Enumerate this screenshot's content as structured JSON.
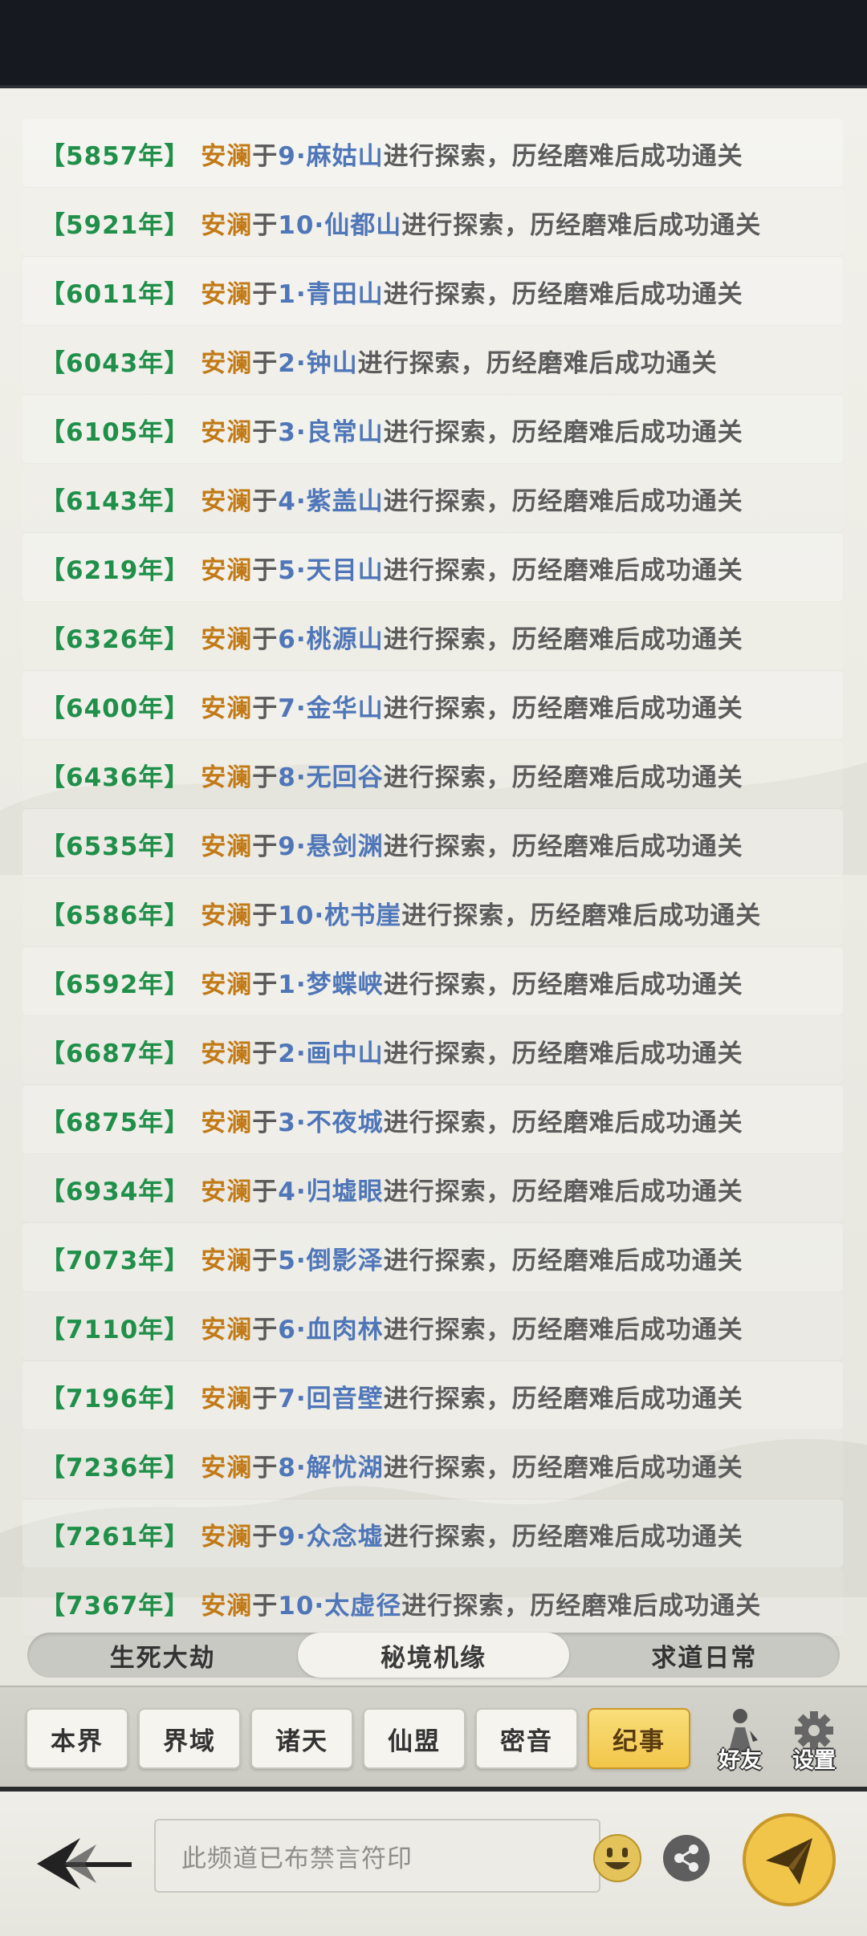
{
  "log": {
    "verb": "进行探索，历经磨难后成功通关",
    "yu": "于",
    "entries": [
      {
        "year": "【5857年】",
        "name": "安澜",
        "place": "9·麻姑山"
      },
      {
        "year": "【5921年】",
        "name": "安澜",
        "place": "10·仙都山"
      },
      {
        "year": "【6011年】",
        "name": "安澜",
        "place": "1·青田山"
      },
      {
        "year": "【6043年】",
        "name": "安澜",
        "place": "2·钟山"
      },
      {
        "year": "【6105年】",
        "name": "安澜",
        "place": "3·良常山"
      },
      {
        "year": "【6143年】",
        "name": "安澜",
        "place": "4·紫盖山"
      },
      {
        "year": "【6219年】",
        "name": "安澜",
        "place": "5·天目山"
      },
      {
        "year": "【6326年】",
        "name": "安澜",
        "place": "6·桃源山"
      },
      {
        "year": "【6400年】",
        "name": "安澜",
        "place": "7·金华山"
      },
      {
        "year": "【6436年】",
        "name": "安澜",
        "place": "8·无回谷"
      },
      {
        "year": "【6535年】",
        "name": "安澜",
        "place": "9·悬剑渊"
      },
      {
        "year": "【6586年】",
        "name": "安澜",
        "place": "10·枕书崖"
      },
      {
        "year": "【6592年】",
        "name": "安澜",
        "place": "1·梦蝶峡"
      },
      {
        "year": "【6687年】",
        "name": "安澜",
        "place": "2·画中山"
      },
      {
        "year": "【6875年】",
        "name": "安澜",
        "place": "3·不夜城"
      },
      {
        "year": "【6934年】",
        "name": "安澜",
        "place": "4·归墟眼"
      },
      {
        "year": "【7073年】",
        "name": "安澜",
        "place": "5·倒影泽"
      },
      {
        "year": "【7110年】",
        "name": "安澜",
        "place": "6·血肉林"
      },
      {
        "year": "【7196年】",
        "name": "安澜",
        "place": "7·回音壁"
      },
      {
        "year": "【7236年】",
        "name": "安澜",
        "place": "8·解忧湖"
      },
      {
        "year": "【7261年】",
        "name": "安澜",
        "place": "9·众念墟"
      },
      {
        "year": "【7367年】",
        "name": "安澜",
        "place": "10·太虚径"
      }
    ]
  },
  "subtabs": [
    "生死大劫",
    "秘境机缘",
    "求道日常"
  ],
  "subtab_active": "秘境机缘",
  "channels": [
    "本界",
    "界域",
    "诸天",
    "仙盟",
    "密音",
    "纪事"
  ],
  "channel_active": "纪事",
  "side": {
    "friends": "好友",
    "settings": "设置"
  },
  "input": {
    "placeholder": "此频道已布禁言符印"
  },
  "colors": {
    "year": "#1f8f4a",
    "name": "#c27a16",
    "place": "#4f76b8",
    "active_tab": "#f2c64a"
  },
  "icons": {
    "back": "back-arrow-icon",
    "emoji": "emoji-icon",
    "share": "share-icon",
    "send": "send-icon",
    "friends": "friend-icon",
    "settings": "gear-icon"
  }
}
